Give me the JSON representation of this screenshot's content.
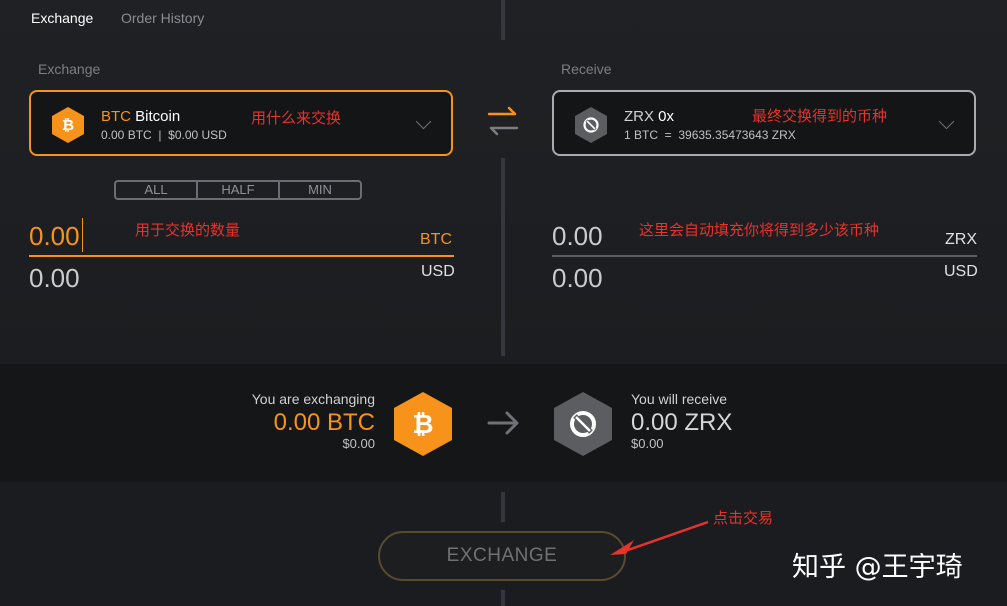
{
  "tabs": [
    {
      "label": "Exchange",
      "active": true
    },
    {
      "label": "Order History",
      "active": false
    }
  ],
  "exchange": {
    "section_label": "Exchange",
    "coin_symbol": "BTC",
    "coin_name": "Bitcoin",
    "balance": "0.00 BTC  |  $0.00 USD",
    "annotation": "用什么来交换",
    "amount_buttons": [
      "ALL",
      "HALF",
      "MIN"
    ],
    "amount_value": "0.00",
    "amount_unit": "BTC",
    "amount_annotation": "用于交换的数量",
    "usd_value": "0.00",
    "usd_unit": "USD"
  },
  "receive": {
    "section_label": "Receive",
    "coin_symbol": "ZRX",
    "coin_name": "0x",
    "rate": "1 BTC  =  39635.35473643 ZRX",
    "annotation": "最终交换得到的币种",
    "amount_value": "0.00",
    "amount_unit": "ZRX",
    "amount_annotation": "这里会自动填充你将得到多少该币种",
    "usd_value": "0.00",
    "usd_unit": "USD"
  },
  "summary": {
    "left_label": "You are exchanging",
    "left_amount": "0.00 BTC",
    "left_usd": "$0.00",
    "right_label": "You will receive",
    "right_amount": "0.00 ZRX",
    "right_usd": "$0.00"
  },
  "exchange_button": {
    "label": "EXCHANGE",
    "annotation": "点击交易"
  },
  "watermark": "知乎 @王宇琦",
  "colors": {
    "accent": "#f7931a",
    "annotation": "#e8322c",
    "zrx_gray": "#5b5d60",
    "background": "#1e2023"
  },
  "icons": {
    "btc": "bitcoin-icon",
    "zrx": "zrx-icon",
    "swap": "swap-arrows-icon",
    "direction": "arrow-right-icon"
  }
}
